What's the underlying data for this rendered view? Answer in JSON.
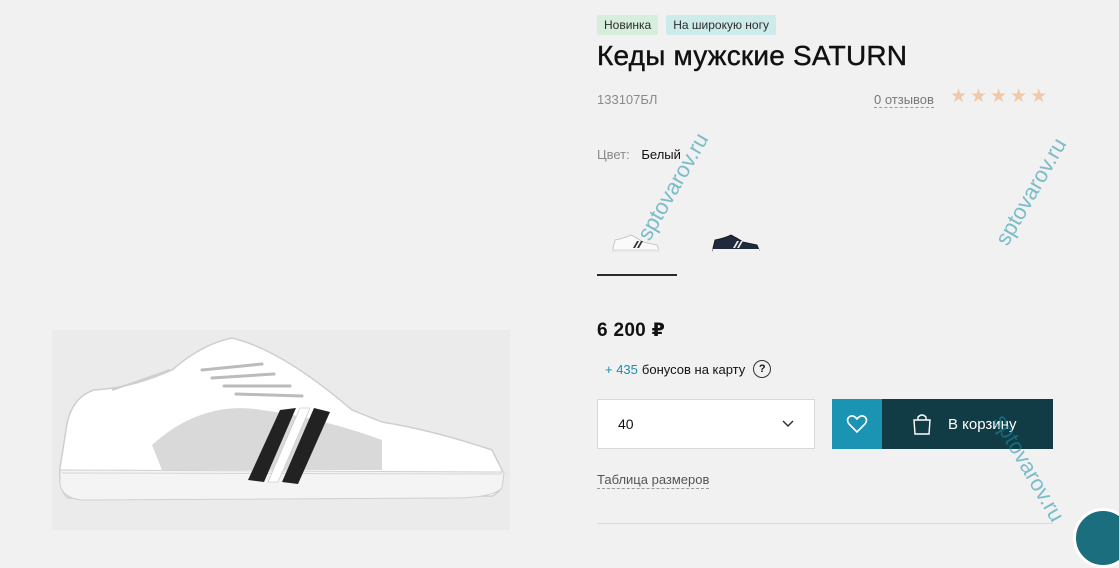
{
  "product": {
    "badges": [
      "Новинка",
      "На широкую ногу"
    ],
    "title": "Кеды мужские SATURN",
    "sku": "133107БЛ",
    "reviews_text": "0 отзывов",
    "rating_stars": 5,
    "rating_value": 0,
    "color_label": "Цвет:",
    "color_value": "Белый",
    "swatches": [
      {
        "name": "white",
        "selected": true
      },
      {
        "name": "navy",
        "selected": false
      }
    ],
    "price": "6 200 ₽",
    "bonus": {
      "amount": "+ 435",
      "text": "бонусов на карту",
      "help_icon": "?"
    },
    "size": {
      "selected": "40"
    },
    "cart_button": "В корзину",
    "size_table_link": "Таблица размеров"
  },
  "watermark": "sptovarov.ru",
  "colors": {
    "accent": "#1b93b3",
    "cart": "#123c45",
    "badge_new": "#d6eedb",
    "badge_wide": "#cdebeb",
    "star": "#f0c9a8"
  },
  "icons": {
    "wish": "heart-icon",
    "cart": "shopping-bag-icon",
    "dropdown": "chevron-down-icon",
    "help": "question-icon",
    "rating": "star-icon",
    "chat": "chat-icon"
  }
}
